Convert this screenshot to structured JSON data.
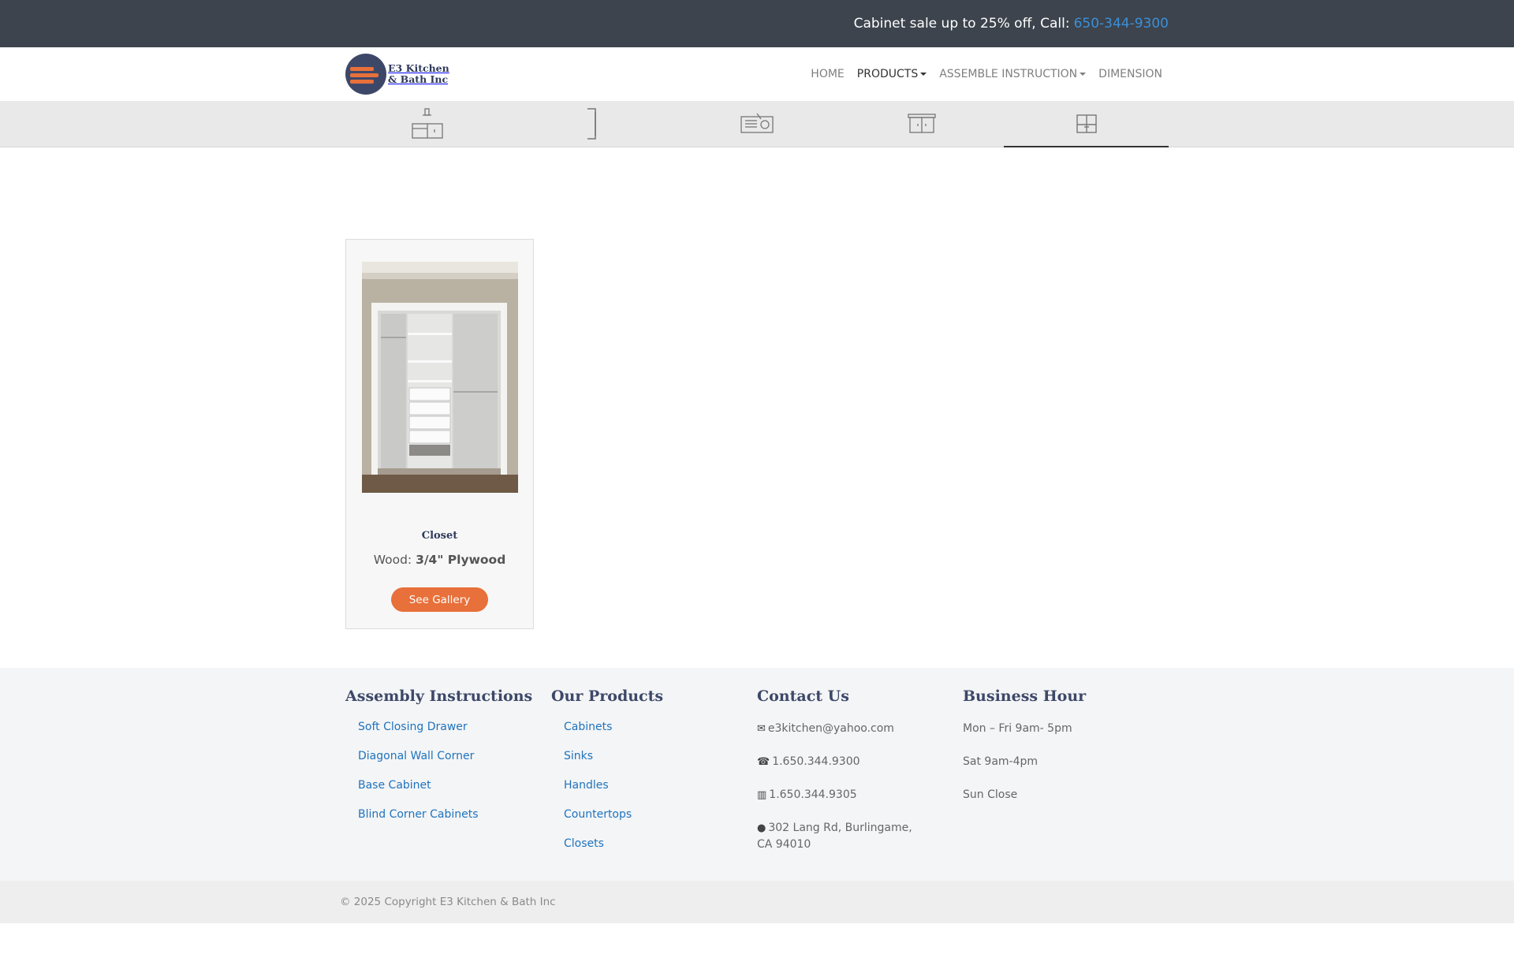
{
  "topbar": {
    "promo": "Cabinet sale up to 25% off, Call:",
    "phone": "650-344-9300"
  },
  "logo": {
    "line1": "E3 Kitchen",
    "line2": "& Bath Inc"
  },
  "nav": {
    "home": "HOME",
    "products": "PRODUCTS",
    "assemble": "ASSEMBLE INSTRUCTION",
    "dimension": "DIMENSION"
  },
  "iconbar": {
    "items": [
      "cabinet-icon",
      "handle-icon",
      "sink-icon",
      "countertop-icon",
      "closet-icon"
    ],
    "active_index": 4
  },
  "product": {
    "title": "Closet",
    "wood_label": "Wood:",
    "wood_value": "3/4\" Plywood",
    "button": "See Gallery"
  },
  "footer": {
    "assembly": {
      "title": "Assembly Instructions",
      "items": [
        "Soft Closing Drawer",
        "Diagonal Wall Corner",
        "Base Cabinet",
        "Blind Corner Cabinets"
      ]
    },
    "products": {
      "title": "Our Products",
      "items": [
        "Cabinets",
        "Sinks",
        "Handles",
        "Countertops",
        "Closets"
      ]
    },
    "contact": {
      "title": "Contact Us",
      "email": "e3kitchen@yahoo.com",
      "phone": "1.650.344.9300",
      "fax": "1.650.344.9305",
      "address": "302 Lang Rd, Burlingame, CA 94010"
    },
    "hours": {
      "title": "Business Hour",
      "weekday": "Mon – Fri 9am- 5pm",
      "saturday": "Sat 9am-4pm",
      "sunday": "Sun Close"
    },
    "copyright": "© 2025 Copyright E3 Kitchen & Bath Inc"
  },
  "colors": {
    "topbar_bg": "#3d444d",
    "accent_orange": "#e8703a",
    "link_blue": "#1e73be",
    "heading_navy": "#3d4869"
  }
}
